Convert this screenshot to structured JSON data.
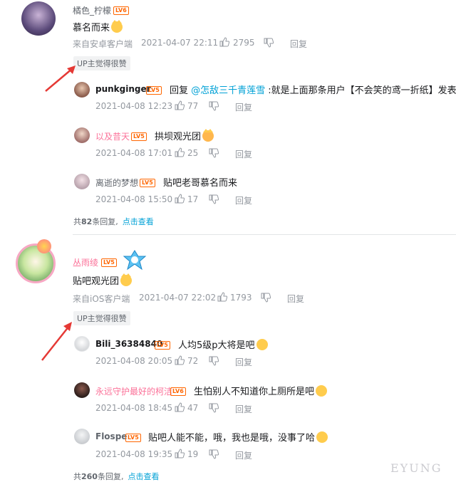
{
  "colors": {
    "accent_link": "#00a1d6",
    "meta_gray": "#9499a0",
    "pink_name": "#fb7299",
    "arrow_red": "#e53935",
    "level_orange": "#ff6600"
  },
  "comments": [
    {
      "user": "橘色_柠檬",
      "level": "LV6",
      "content": "慕名而来",
      "emoji": "cat-emoji",
      "source": "来自安卓客户端",
      "time": "2021-04-07 22:11",
      "likes": "2795",
      "reply_label": "回复",
      "up_badge": "UP主觉得很赞",
      "replies": [
        {
          "user": "punkginger",
          "level": "LV5",
          "reply_prefix": "回复 ",
          "mention": "@怎敌三千青莲雪",
          "content": " :就是上面那条用户【不会笑的鸢一折纸】发表的",
          "time": "2021-04-08 12:23",
          "likes": "77",
          "reply_label": "回复"
        },
        {
          "user": "以及昔天",
          "level": "LV5",
          "content": "拱坝观光团",
          "emoji": "shocked-cat-emoji",
          "time": "2021-04-08 17:01",
          "likes": "25",
          "reply_label": "回复"
        },
        {
          "user": "离逝的梦想",
          "level": "LV5",
          "content": "贴吧老哥慕名而来",
          "time": "2021-04-08 15:50",
          "likes": "17",
          "reply_label": "回复"
        }
      ],
      "more_prefix": "共",
      "more_count": "82",
      "more_suffix": "条回复,",
      "more_link": "点击查看"
    },
    {
      "user": "丛雨绫",
      "level": "LV5",
      "content": "贴吧观光团",
      "emoji": "cat-emoji",
      "source": "来自iOS客户端",
      "time": "2021-04-07 22:02",
      "likes": "1793",
      "reply_label": "回复",
      "up_badge": "UP主觉得很赞",
      "replies": [
        {
          "user": "Bili_36384840",
          "level": "LV5",
          "content": "人均5级p大将是吧",
          "emoji": "grin-emoji",
          "time": "2021-04-08 20:05",
          "likes": "72",
          "reply_label": "回复"
        },
        {
          "user": "永远守护最好的柯洁",
          "level": "LV6",
          "content": "生怕别人不知道你上厕所是吧",
          "emoji": "grin-emoji",
          "time": "2021-04-08 18:45",
          "likes": "47",
          "reply_label": "回复"
        },
        {
          "user": "Flospe",
          "level": "LV5",
          "content": "贴吧人能不能，哦，我也是哦，没事了哈",
          "emoji": "grin-emoji",
          "time": "2021-04-08 19:35",
          "likes": "19",
          "reply_label": "回复"
        }
      ],
      "more_prefix": "共",
      "more_count": "260",
      "more_suffix": "条回复,",
      "more_link": "点击查看"
    }
  ],
  "watermark": "EYUNG"
}
